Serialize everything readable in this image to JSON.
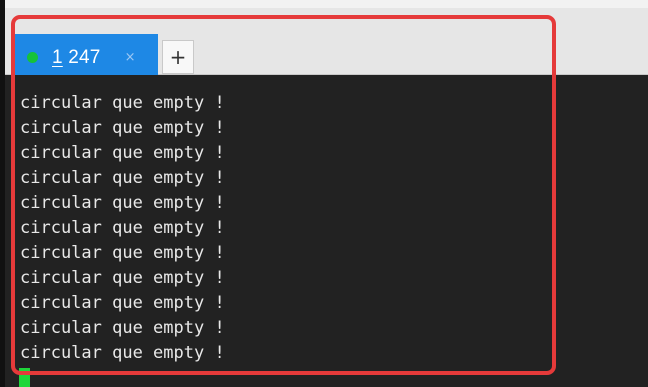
{
  "tab": {
    "title_mnemonic": "1",
    "title_rest": " 247",
    "close_label": "×",
    "status_color": "#16c23a",
    "accent_color": "#1e88e5"
  },
  "new_tab_label": "+",
  "terminal": {
    "lines": [
      "circular que empty !",
      "circular que empty !",
      "circular que empty !",
      "circular que empty !",
      "circular que empty !",
      "circular que empty !",
      "circular que empty !",
      "circular que empty !",
      "circular que empty !",
      "circular que empty !",
      "circular que empty !"
    ],
    "cursor_color": "#1fd63a"
  },
  "annotation": {
    "highlight_color": "#e53a3a"
  }
}
